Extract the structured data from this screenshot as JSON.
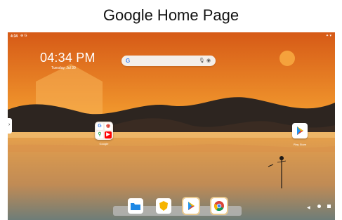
{
  "caption": "Google Home Page",
  "status_bar": {
    "time": "4:34",
    "left_icons": "⊕ G",
    "right_icons": "✦ ▾"
  },
  "clock": {
    "time": "04:34 PM",
    "date": "Tuesday, Jul 30"
  },
  "search": {
    "logo": "G",
    "mic_icon": "mic-icon",
    "lens_icon": "lens-icon"
  },
  "home_icons": [
    {
      "name": "Google",
      "type": "folder"
    },
    {
      "name": "Play Store",
      "type": "app"
    }
  ],
  "dock": [
    "files-icon",
    "launcher-shield-icon",
    "play-store-icon",
    "chrome-icon"
  ],
  "nav": {
    "back": "◀"
  },
  "colors": {
    "sky_top": "#d8611a",
    "sky_mid": "#f2962b",
    "sun": "#f5a23c",
    "dunes_dark": "#2a2420",
    "dock_bg": "#bebebe"
  }
}
